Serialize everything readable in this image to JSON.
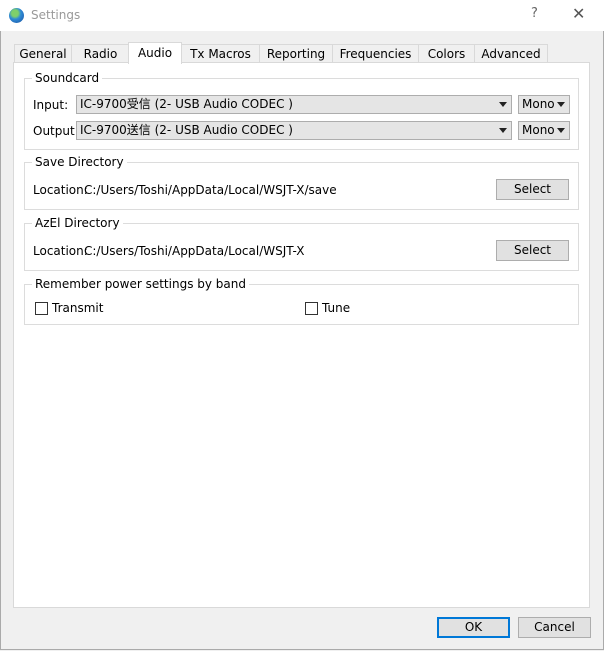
{
  "window": {
    "title": "Settings",
    "help": "?",
    "close": "✕"
  },
  "tabs": [
    "General",
    "Radio",
    "Audio",
    "Tx Macros",
    "Reporting",
    "Frequencies",
    "Colors",
    "Advanced"
  ],
  "soundcard": {
    "title": "Soundcard",
    "input_label": "Input:",
    "input_value": "IC-9700受信 (2- USB Audio CODEC )",
    "input_channel": "Mono",
    "output_label": "Output:",
    "output_value": "IC-9700送信 (2- USB Audio CODEC )",
    "output_channel": "Mono"
  },
  "save_dir": {
    "title": "Save Directory",
    "label": "Location:",
    "path": "C:/Users/Toshi/AppData/Local/WSJT-X/save",
    "button": "Select"
  },
  "azel_dir": {
    "title": "AzEl Directory",
    "label": "Location:",
    "path": "C:/Users/Toshi/AppData/Local/WSJT-X",
    "button": "Select"
  },
  "power": {
    "title": "Remember power settings by band",
    "transmit": "Transmit",
    "tune": "Tune"
  },
  "footer": {
    "ok": "OK",
    "cancel": "Cancel"
  }
}
